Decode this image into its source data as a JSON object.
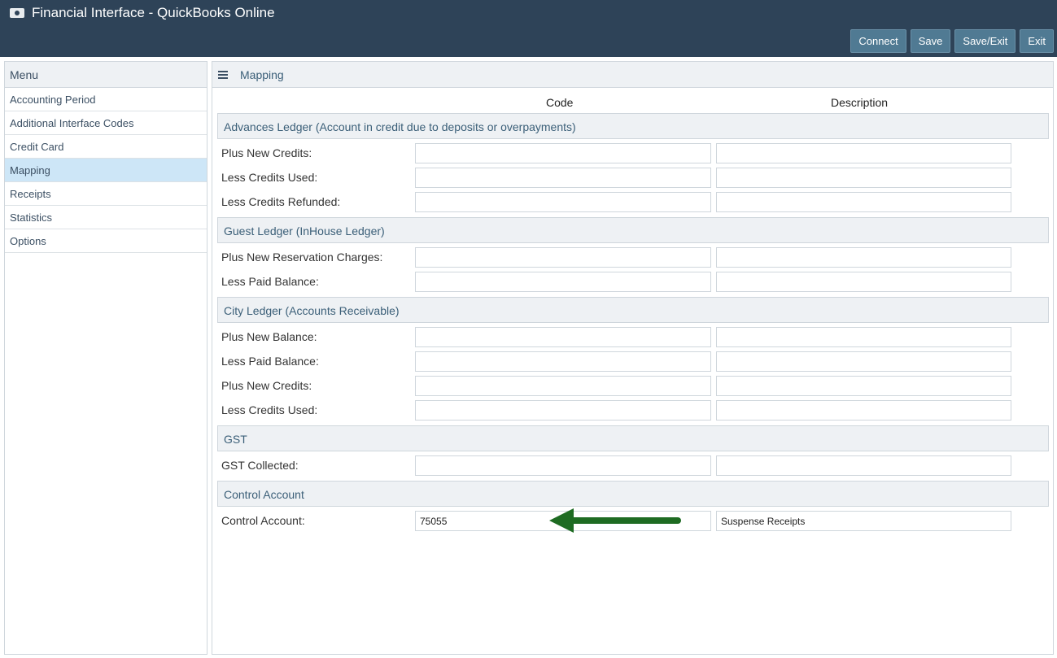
{
  "window": {
    "title": "Financial Interface - QuickBooks Online",
    "icon": "money-icon"
  },
  "toolbar": {
    "connect": "Connect",
    "save": "Save",
    "save_exit": "Save/Exit",
    "exit": "Exit"
  },
  "menu": {
    "title": "Menu",
    "items": [
      {
        "label": "Accounting Period"
      },
      {
        "label": "Additional Interface Codes"
      },
      {
        "label": "Credit Card"
      },
      {
        "label": "Mapping"
      },
      {
        "label": "Receipts"
      },
      {
        "label": "Statistics"
      },
      {
        "label": "Options"
      }
    ],
    "active": "Mapping"
  },
  "panel": {
    "title": "Mapping",
    "col_code": "Code",
    "col_description": "Description",
    "sections": {
      "advances": {
        "title": "Advances Ledger (Account in credit due to deposits or overpayments)",
        "rows": [
          {
            "label": "Plus New Credits:",
            "code": "",
            "description": ""
          },
          {
            "label": "Less Credits Used:",
            "code": "",
            "description": ""
          },
          {
            "label": "Less Credits Refunded:",
            "code": "",
            "description": ""
          }
        ]
      },
      "guest": {
        "title": "Guest Ledger (InHouse Ledger)",
        "rows": [
          {
            "label": "Plus New Reservation Charges:",
            "code": "",
            "description": ""
          },
          {
            "label": "Less Paid Balance:",
            "code": "",
            "description": ""
          }
        ]
      },
      "city": {
        "title": "City Ledger (Accounts Receivable)",
        "rows": [
          {
            "label": "Plus New Balance:",
            "code": "",
            "description": ""
          },
          {
            "label": "Less Paid Balance:",
            "code": "",
            "description": ""
          },
          {
            "label": "Plus New Credits:",
            "code": "",
            "description": ""
          },
          {
            "label": "Less Credits Used:",
            "code": "",
            "description": ""
          }
        ]
      },
      "gst": {
        "title": "GST",
        "rows": [
          {
            "label": "GST Collected:",
            "code": "",
            "description": ""
          }
        ]
      },
      "control": {
        "title": "Control Account",
        "rows": [
          {
            "label": "Control Account:",
            "code": "75055",
            "description": "Suspense Receipts"
          }
        ]
      }
    }
  },
  "annotation": {
    "arrow_color": "#1e6b22",
    "icon": "arrow-left-icon"
  }
}
